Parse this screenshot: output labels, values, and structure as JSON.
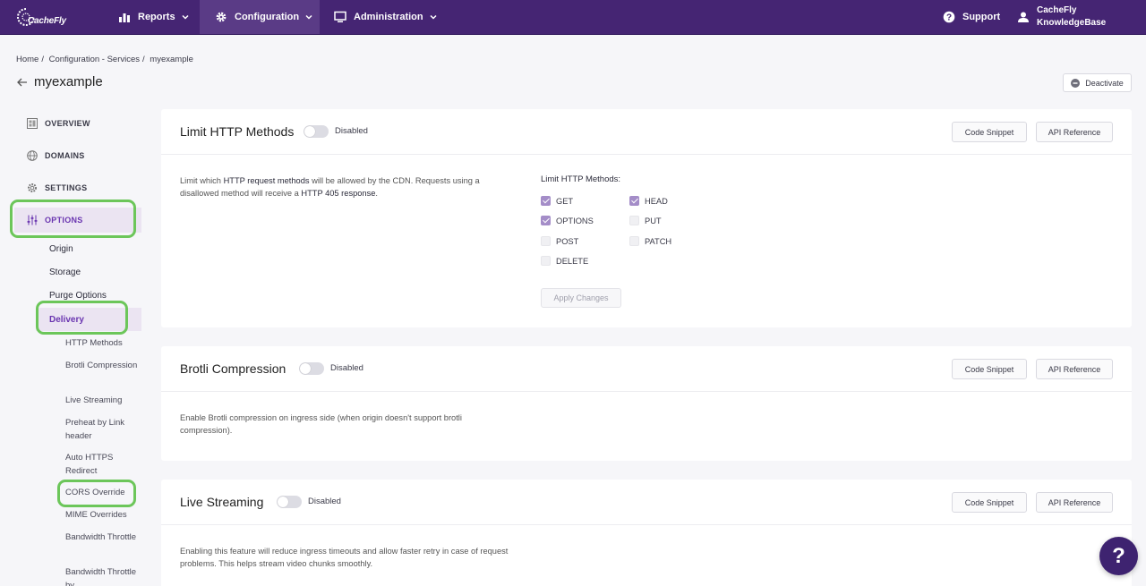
{
  "nav": {
    "logo_text": "CacheFly",
    "reports": "Reports",
    "configuration": "Configuration",
    "administration": "Administration",
    "support": "Support",
    "user_line1": "CacheFly",
    "user_line2": "KnowledgeBase"
  },
  "breadcrumb": {
    "home": "Home",
    "sep": "/",
    "services": "Configuration - Services",
    "current": "myexample"
  },
  "page": {
    "title": "myexample",
    "deactivate": "Deactivate"
  },
  "sidebar": {
    "main": [
      {
        "label": "OVERVIEW",
        "icon": "overview-icon"
      },
      {
        "label": "DOMAINS",
        "icon": "globe-icon"
      },
      {
        "label": "SETTINGS",
        "icon": "gear-icon"
      },
      {
        "label": "OPTIONS",
        "icon": "sliders-icon"
      }
    ],
    "sub": [
      "Origin",
      "Storage",
      "Purge Options",
      "Delivery"
    ],
    "delivery_items": [
      "HTTP Methods",
      "Brotli Compression",
      "Live Streaming",
      "Preheat by Link header",
      "Auto HTTPS Redirect",
      "CORS Override",
      "MIME Overrides",
      "Bandwidth Throttle",
      "Bandwidth Throttle by"
    ]
  },
  "cards": [
    {
      "title": "Limit HTTP Methods",
      "status": "Disabled",
      "code_snippet": "Code Snippet",
      "api_reference": "API Reference",
      "desc_1": "Limit which ",
      "desc_b1": "HTTP request methods",
      "desc_2": " will be allowed by the CDN. Requests using a disallowed method will receive a ",
      "desc_b2": "HTTP 405 response",
      "desc_3": ".",
      "methods_title": "Limit HTTP Methods:",
      "methods": [
        {
          "label": "GET",
          "checked": true
        },
        {
          "label": "HEAD",
          "checked": true
        },
        {
          "label": "OPTIONS",
          "checked": true
        },
        {
          "label": "PUT",
          "checked": false
        },
        {
          "label": "POST",
          "checked": false
        },
        {
          "label": "PATCH",
          "checked": false
        },
        {
          "label": "DELETE",
          "checked": false
        }
      ],
      "apply": "Apply Changes"
    },
    {
      "title": "Brotli Compression",
      "status": "Disabled",
      "code_snippet": "Code Snippet",
      "api_reference": "API Reference",
      "desc": "Enable Brotli compression on ingress side (when origin doesn't support brotli compression)."
    },
    {
      "title": "Live Streaming",
      "status": "Disabled",
      "code_snippet": "Code Snippet",
      "api_reference": "API Reference",
      "desc": "Enabling this feature will reduce ingress timeouts and allow faster retry in case of request problems. This helps stream video chunks smoothly."
    }
  ],
  "help": "?",
  "colors": {
    "nav_bg": "#452573",
    "accent": "#6a35b0",
    "highlight": "#6cc65a",
    "checkbox_on": "#a48dc8"
  }
}
